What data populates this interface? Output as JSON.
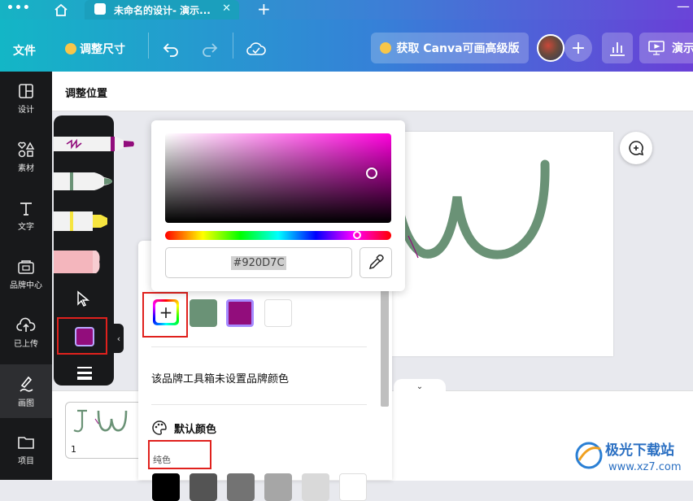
{
  "browser": {
    "tab_title": "未命名的设计- 演示...",
    "new_tab_symbol": "+",
    "close_symbol": "✕",
    "menu_dots": "•••",
    "window_min": "—"
  },
  "toolbar": {
    "file_label": "文件",
    "resize_label": "调整尺寸",
    "upgrade_label": "获取 Canva可画高级版",
    "add_symbol": "+",
    "present_label": "演示"
  },
  "sidebar": {
    "items": [
      {
        "label": "设计",
        "icon": "layout-icon"
      },
      {
        "label": "素材",
        "icon": "elements-icon"
      },
      {
        "label": "文字",
        "icon": "text-icon"
      },
      {
        "label": "品牌中心",
        "icon": "brand-icon"
      },
      {
        "label": "已上传",
        "icon": "upload-icon"
      },
      {
        "label": "画图",
        "icon": "draw-icon",
        "active": true
      },
      {
        "label": "项目",
        "icon": "folder-icon"
      }
    ]
  },
  "subheader": {
    "title": "调整位置"
  },
  "picker": {
    "hex_value": "#920D7C"
  },
  "color_panel": {
    "add_symbol": "+",
    "document_colors": [
      "#6a9276",
      "#920D7C",
      "#ffffff"
    ],
    "no_brand_text": "该品牌工具箱未设置品牌颜色",
    "default_colors_label": "默认颜色",
    "solid_label": "纯色",
    "solid_colors": [
      "#000000",
      "#545454",
      "#737373",
      "#a6a6a6",
      "#d9d9d9",
      "#ffffff"
    ]
  },
  "pages": {
    "page_number": "1",
    "collapse_symbol": "⌄"
  },
  "colors": {
    "accent_red": "#e0211d",
    "stroke_green": "#6a9276",
    "selected_color": "#920D7C"
  }
}
